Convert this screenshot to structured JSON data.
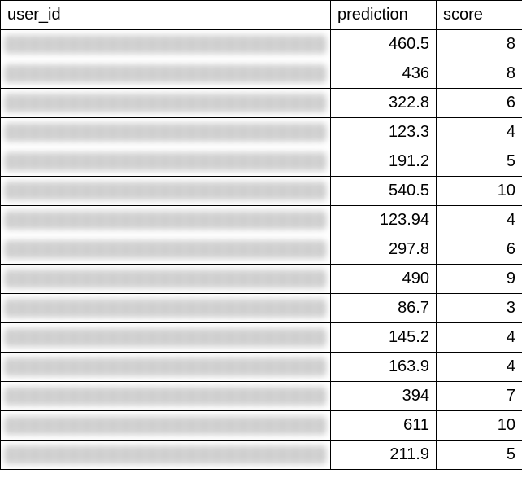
{
  "headers": {
    "user_id": "user_id",
    "prediction": "prediction",
    "score": "score"
  },
  "rows": [
    {
      "prediction": "460.5",
      "score": "8"
    },
    {
      "prediction": "436",
      "score": "8"
    },
    {
      "prediction": "322.8",
      "score": "6"
    },
    {
      "prediction": "123.3",
      "score": "4"
    },
    {
      "prediction": "191.2",
      "score": "5"
    },
    {
      "prediction": "540.5",
      "score": "10"
    },
    {
      "prediction": "123.94",
      "score": "4"
    },
    {
      "prediction": "297.8",
      "score": "6"
    },
    {
      "prediction": "490",
      "score": "9"
    },
    {
      "prediction": "86.7",
      "score": "3"
    },
    {
      "prediction": "145.2",
      "score": "4"
    },
    {
      "prediction": "163.9",
      "score": "4"
    },
    {
      "prediction": "394",
      "score": "7"
    },
    {
      "prediction": "611",
      "score": "10"
    },
    {
      "prediction": "211.9",
      "score": "5"
    }
  ]
}
